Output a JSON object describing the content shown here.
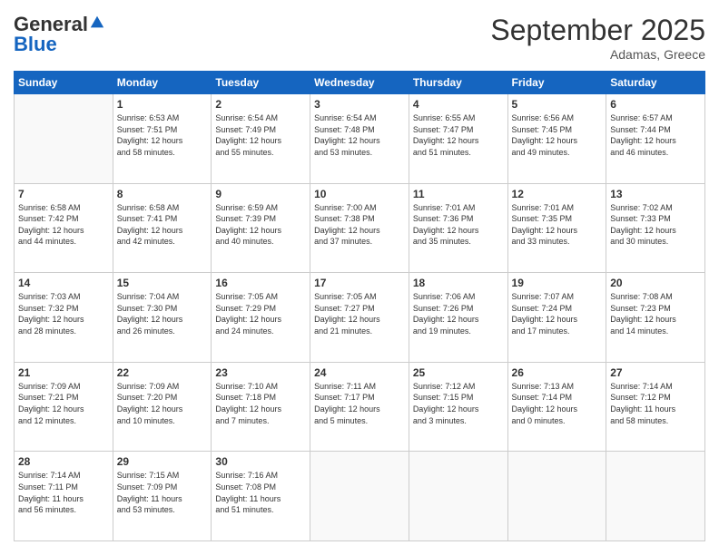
{
  "logo": {
    "general": "General",
    "blue": "Blue"
  },
  "title": "September 2025",
  "location": "Adamas, Greece",
  "days_header": [
    "Sunday",
    "Monday",
    "Tuesday",
    "Wednesday",
    "Thursday",
    "Friday",
    "Saturday"
  ],
  "weeks": [
    [
      {
        "day": "",
        "info": ""
      },
      {
        "day": "1",
        "info": "Sunrise: 6:53 AM\nSunset: 7:51 PM\nDaylight: 12 hours\nand 58 minutes."
      },
      {
        "day": "2",
        "info": "Sunrise: 6:54 AM\nSunset: 7:49 PM\nDaylight: 12 hours\nand 55 minutes."
      },
      {
        "day": "3",
        "info": "Sunrise: 6:54 AM\nSunset: 7:48 PM\nDaylight: 12 hours\nand 53 minutes."
      },
      {
        "day": "4",
        "info": "Sunrise: 6:55 AM\nSunset: 7:47 PM\nDaylight: 12 hours\nand 51 minutes."
      },
      {
        "day": "5",
        "info": "Sunrise: 6:56 AM\nSunset: 7:45 PM\nDaylight: 12 hours\nand 49 minutes."
      },
      {
        "day": "6",
        "info": "Sunrise: 6:57 AM\nSunset: 7:44 PM\nDaylight: 12 hours\nand 46 minutes."
      }
    ],
    [
      {
        "day": "7",
        "info": "Sunrise: 6:58 AM\nSunset: 7:42 PM\nDaylight: 12 hours\nand 44 minutes."
      },
      {
        "day": "8",
        "info": "Sunrise: 6:58 AM\nSunset: 7:41 PM\nDaylight: 12 hours\nand 42 minutes."
      },
      {
        "day": "9",
        "info": "Sunrise: 6:59 AM\nSunset: 7:39 PM\nDaylight: 12 hours\nand 40 minutes."
      },
      {
        "day": "10",
        "info": "Sunrise: 7:00 AM\nSunset: 7:38 PM\nDaylight: 12 hours\nand 37 minutes."
      },
      {
        "day": "11",
        "info": "Sunrise: 7:01 AM\nSunset: 7:36 PM\nDaylight: 12 hours\nand 35 minutes."
      },
      {
        "day": "12",
        "info": "Sunrise: 7:01 AM\nSunset: 7:35 PM\nDaylight: 12 hours\nand 33 minutes."
      },
      {
        "day": "13",
        "info": "Sunrise: 7:02 AM\nSunset: 7:33 PM\nDaylight: 12 hours\nand 30 minutes."
      }
    ],
    [
      {
        "day": "14",
        "info": "Sunrise: 7:03 AM\nSunset: 7:32 PM\nDaylight: 12 hours\nand 28 minutes."
      },
      {
        "day": "15",
        "info": "Sunrise: 7:04 AM\nSunset: 7:30 PM\nDaylight: 12 hours\nand 26 minutes."
      },
      {
        "day": "16",
        "info": "Sunrise: 7:05 AM\nSunset: 7:29 PM\nDaylight: 12 hours\nand 24 minutes."
      },
      {
        "day": "17",
        "info": "Sunrise: 7:05 AM\nSunset: 7:27 PM\nDaylight: 12 hours\nand 21 minutes."
      },
      {
        "day": "18",
        "info": "Sunrise: 7:06 AM\nSunset: 7:26 PM\nDaylight: 12 hours\nand 19 minutes."
      },
      {
        "day": "19",
        "info": "Sunrise: 7:07 AM\nSunset: 7:24 PM\nDaylight: 12 hours\nand 17 minutes."
      },
      {
        "day": "20",
        "info": "Sunrise: 7:08 AM\nSunset: 7:23 PM\nDaylight: 12 hours\nand 14 minutes."
      }
    ],
    [
      {
        "day": "21",
        "info": "Sunrise: 7:09 AM\nSunset: 7:21 PM\nDaylight: 12 hours\nand 12 minutes."
      },
      {
        "day": "22",
        "info": "Sunrise: 7:09 AM\nSunset: 7:20 PM\nDaylight: 12 hours\nand 10 minutes."
      },
      {
        "day": "23",
        "info": "Sunrise: 7:10 AM\nSunset: 7:18 PM\nDaylight: 12 hours\nand 7 minutes."
      },
      {
        "day": "24",
        "info": "Sunrise: 7:11 AM\nSunset: 7:17 PM\nDaylight: 12 hours\nand 5 minutes."
      },
      {
        "day": "25",
        "info": "Sunrise: 7:12 AM\nSunset: 7:15 PM\nDaylight: 12 hours\nand 3 minutes."
      },
      {
        "day": "26",
        "info": "Sunrise: 7:13 AM\nSunset: 7:14 PM\nDaylight: 12 hours\nand 0 minutes."
      },
      {
        "day": "27",
        "info": "Sunrise: 7:14 AM\nSunset: 7:12 PM\nDaylight: 11 hours\nand 58 minutes."
      }
    ],
    [
      {
        "day": "28",
        "info": "Sunrise: 7:14 AM\nSunset: 7:11 PM\nDaylight: 11 hours\nand 56 minutes."
      },
      {
        "day": "29",
        "info": "Sunrise: 7:15 AM\nSunset: 7:09 PM\nDaylight: 11 hours\nand 53 minutes."
      },
      {
        "day": "30",
        "info": "Sunrise: 7:16 AM\nSunset: 7:08 PM\nDaylight: 11 hours\nand 51 minutes."
      },
      {
        "day": "",
        "info": ""
      },
      {
        "day": "",
        "info": ""
      },
      {
        "day": "",
        "info": ""
      },
      {
        "day": "",
        "info": ""
      }
    ]
  ]
}
